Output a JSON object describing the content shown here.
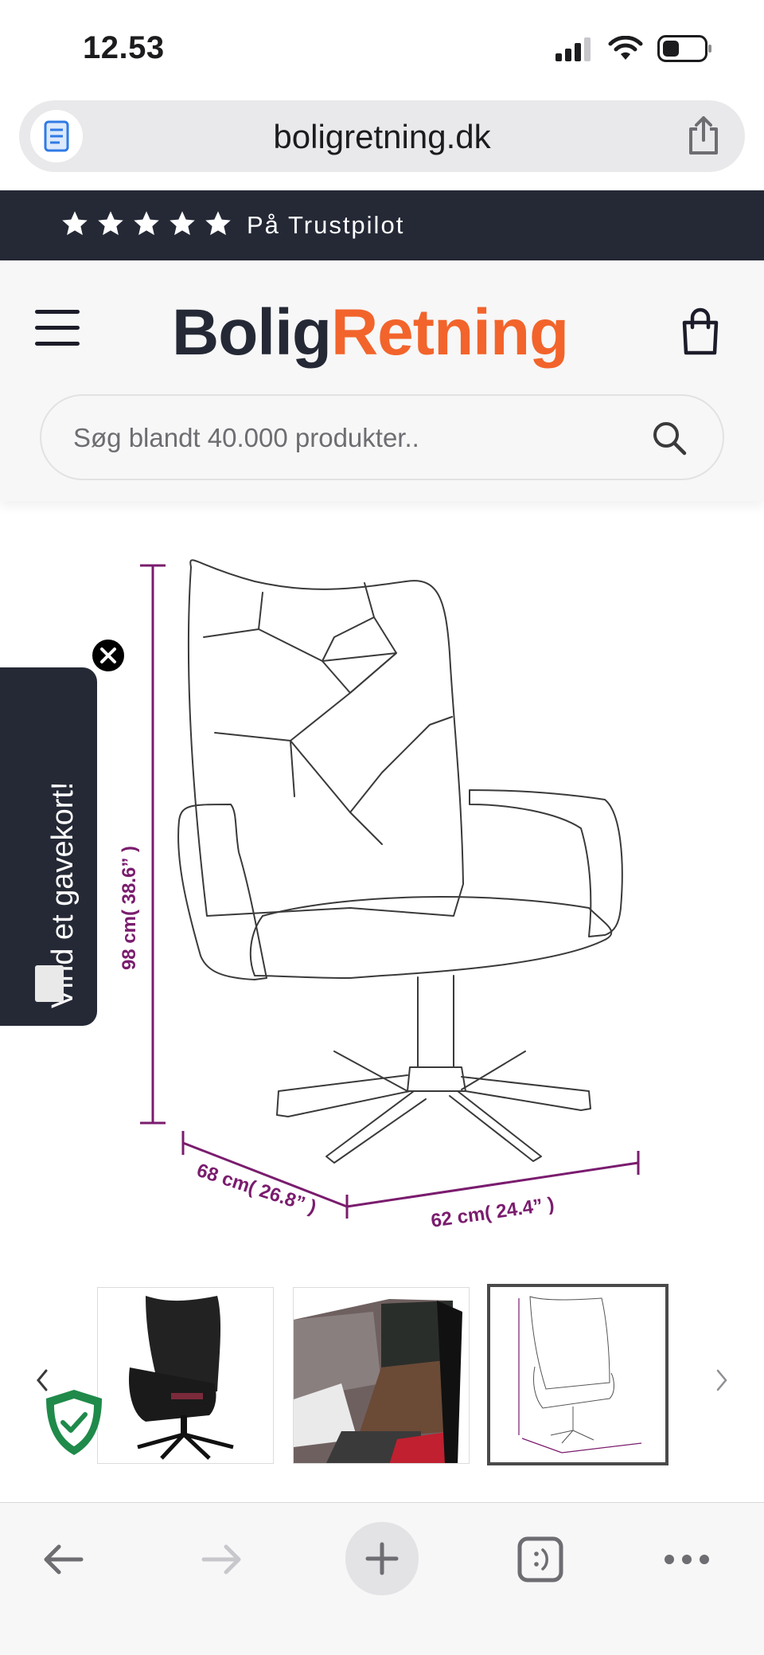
{
  "status_bar": {
    "time": "12.53"
  },
  "browser": {
    "url": "boligretning.dk"
  },
  "trust_banner": {
    "stars": 5,
    "text": "På Trustpilot"
  },
  "header": {
    "logo_part1": "Bolig",
    "logo_part2": "Retning",
    "search_placeholder": "Søg blandt 40.000 produkter.."
  },
  "product_image": {
    "height_label": "98 cm( 38.6” )",
    "depth_label": "68 cm( 26.8” )",
    "width_label": "62 cm( 24.4” )"
  },
  "gift_tab": {
    "label": "Vind et gavekort!"
  },
  "thumbnails": [
    {
      "name": "chair-black"
    },
    {
      "name": "patchwork-fabric"
    },
    {
      "name": "dimension-drawing",
      "active": true
    }
  ],
  "colors": {
    "brand_dark": "#252936",
    "brand_orange": "#f2642b",
    "dimension_purple": "#7a1c6e",
    "shield_green": "#1f8a4a"
  }
}
